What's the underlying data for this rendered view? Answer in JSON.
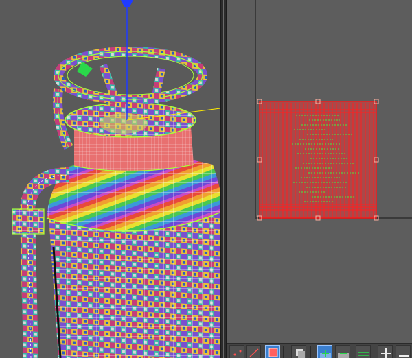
{
  "viewports": {
    "perspective": {
      "label": ""
    },
    "uv_editor": {
      "label": ""
    }
  },
  "toolbar": {
    "tools": [
      {
        "icon": "vertex-mode-icon"
      },
      {
        "icon": "edge-mode-icon"
      },
      {
        "icon": "face-mode-icon",
        "active": true
      },
      {
        "icon": "element-mode-icon"
      },
      {
        "icon": "move-uv-icon"
      },
      {
        "icon": "remove-uv-icon"
      },
      {
        "icon": "align-horizontal-icon"
      },
      {
        "icon": "pan-icon"
      },
      {
        "icon": "zoom-out-icon"
      }
    ]
  },
  "colors": {
    "viewport_bg": "#5a5a5a",
    "uv_bg": "#5d5d5d",
    "wire": "#ffffff",
    "selection_wire": "#a8ff3a",
    "uv_fill": "#e8383a",
    "uv_line": "#ff2020",
    "uv_overlay": "#3cff3c",
    "axis_y": "#1f3bff",
    "axis_x": "#ffee00",
    "active_tool": "#3b7fcf"
  }
}
